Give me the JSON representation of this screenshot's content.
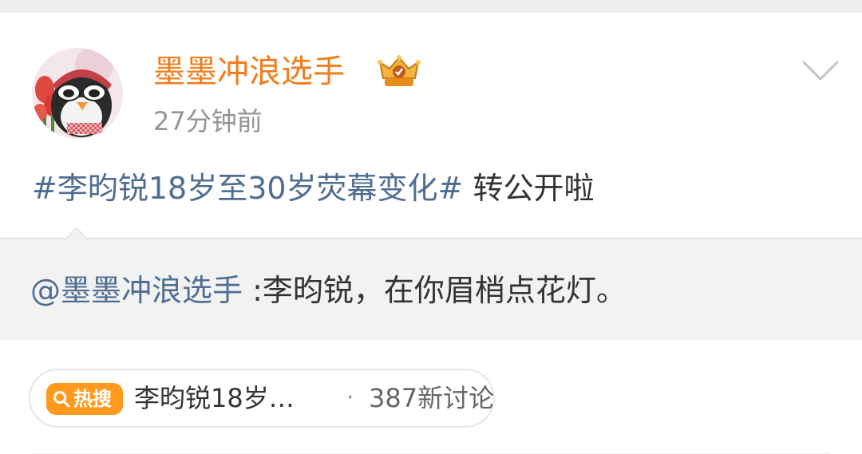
{
  "post": {
    "author": {
      "name": "墨墨冲浪选手",
      "avatar_icon": "penguin-with-sunglasses-avatar",
      "badge_icon": "vip-crown-badge-icon"
    },
    "timestamp": "27分钟前",
    "menu_icon": "chevron-down-icon",
    "body": {
      "hashtag": "#李昀锐18岁至30岁荧幕变化#",
      "text": " 转公开啦"
    },
    "repost": {
      "mention": "@墨墨冲浪选手",
      "text": " :李昀锐，在你眉梢点花灯。"
    },
    "hot_search": {
      "badge_icon": "search-icon",
      "badge_label": "热搜",
      "topic": "李昀锐18岁…",
      "separator": "·",
      "count": "387新讨论"
    }
  },
  "colors": {
    "author_name": "#f07c1a",
    "link": "#4f6d92",
    "text": "#333333",
    "muted": "#939393",
    "hot_badge": "#ff9a1f",
    "repost_bg": "#f2f2f2"
  }
}
